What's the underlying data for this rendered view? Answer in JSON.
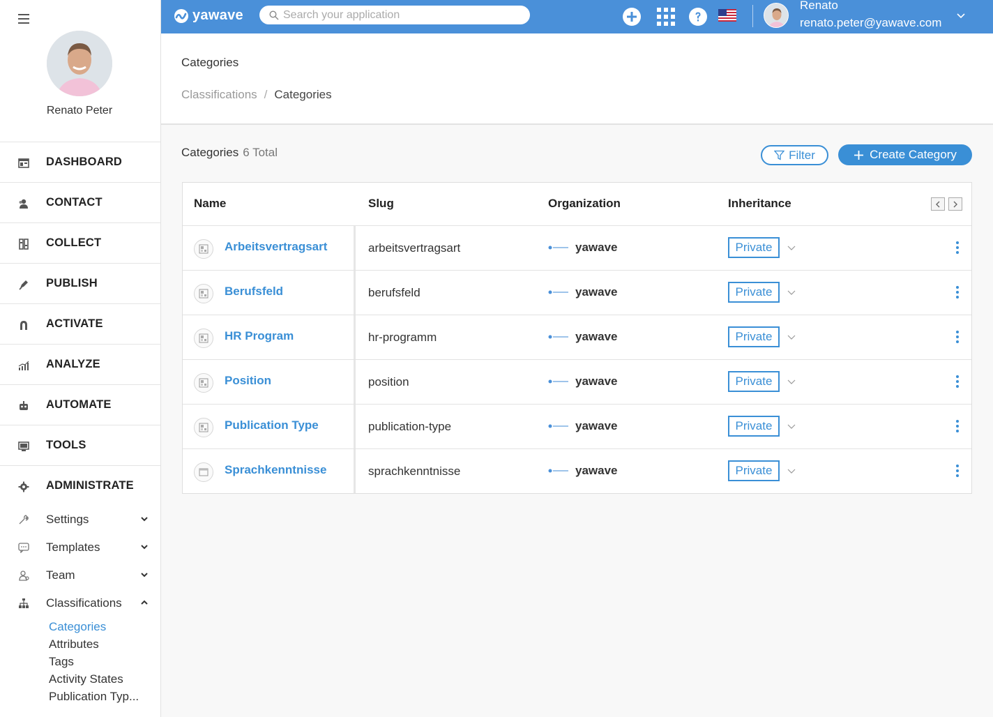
{
  "app": {
    "logo_text": "yawave",
    "colors": {
      "accent": "#3a8fd6",
      "header": "#4a90d9"
    }
  },
  "sidebar": {
    "profile_name": "Renato Peter",
    "main_nav": [
      {
        "label": "DASHBOARD",
        "icon": "dashboard-icon"
      },
      {
        "label": "CONTACT",
        "icon": "contacts-icon"
      },
      {
        "label": "COLLECT",
        "icon": "columns-icon"
      },
      {
        "label": "PUBLISH",
        "icon": "pen-icon"
      },
      {
        "label": "ACTIVATE",
        "icon": "magnet-icon"
      },
      {
        "label": "ANALYZE",
        "icon": "bar-chart-icon"
      },
      {
        "label": "AUTOMATE",
        "icon": "robot-icon"
      },
      {
        "label": "TOOLS",
        "icon": "monitor-icon"
      },
      {
        "label": "ADMINISTRATE",
        "icon": "gear-icon"
      }
    ],
    "sub_nav": [
      {
        "label": "Settings",
        "icon": "wrench-icon"
      },
      {
        "label": "Templates",
        "icon": "chat-icon"
      },
      {
        "label": "Team",
        "icon": "user-icon"
      },
      {
        "label": "Classifications",
        "icon": "hierarchy-icon"
      }
    ],
    "classifications": [
      "Categories",
      "Attributes",
      "Tags",
      "Activity States",
      "Publication Typ..."
    ]
  },
  "header": {
    "search_placeholder": "Search your application",
    "user_name": "Renato",
    "user_email": "renato.peter@yawave.com"
  },
  "page": {
    "title": "Categories",
    "breadcrumb": {
      "parent": "Classifications",
      "separator": "/",
      "current": "Categories"
    }
  },
  "content": {
    "section_title": "Categories",
    "total": "6 Total",
    "filter_label": "Filter",
    "create_label": "Create Category",
    "columns": {
      "name": "Name",
      "slug": "Slug",
      "organization": "Organization",
      "inheritance": "Inheritance"
    },
    "rows": [
      {
        "name": "Arbeitsvertragsart",
        "slug": "arbeitsvertragsart",
        "org": "yawave",
        "inheritance": "Private"
      },
      {
        "name": "Berufsfeld",
        "slug": "berufsfeld",
        "org": "yawave",
        "inheritance": "Private"
      },
      {
        "name": "HR Program",
        "slug": "hr-programm",
        "org": "yawave",
        "inheritance": "Private"
      },
      {
        "name": "Position",
        "slug": "position",
        "org": "yawave",
        "inheritance": "Private"
      },
      {
        "name": "Publication Type",
        "slug": "publication-type",
        "org": "yawave",
        "inheritance": "Private"
      },
      {
        "name": "Sprachkenntnisse",
        "slug": "sprachkenntnisse",
        "org": "yawave",
        "inheritance": "Private"
      }
    ]
  }
}
